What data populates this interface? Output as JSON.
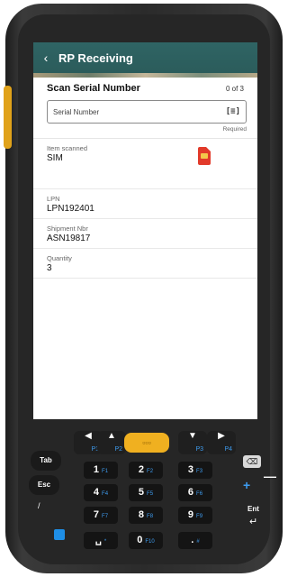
{
  "appbar": {
    "back_icon": "‹",
    "title": "RP Receiving"
  },
  "scan": {
    "title": "Scan Serial Number",
    "counter": "0 of 3",
    "placeholder": "Serial Number",
    "scan_icon_glyph": "[≡]",
    "required_label": "Required"
  },
  "fields": {
    "item": {
      "label": "Item scanned",
      "value": "SIM",
      "icon": "sim-card-icon"
    },
    "lpn": {
      "label": "LPN",
      "value": "LPN192401"
    },
    "shipment": {
      "label": "Shipment Nbr",
      "value": "ASN19817"
    },
    "quantity": {
      "label": "Quantity",
      "value": "3"
    }
  },
  "keypad": {
    "nav": [
      {
        "main": "◀",
        "sub": "P1"
      },
      {
        "main": "▲",
        "sub": "P2"
      },
      {
        "main": "▼",
        "sub": "P3"
      },
      {
        "main": "▶",
        "sub": "P4"
      }
    ],
    "center": "▫▫▫",
    "left_keys": [
      "Tab",
      "Esc"
    ],
    "digits": [
      {
        "main": "1",
        "sub": "F1"
      },
      {
        "main": "2",
        "sub": "F2"
      },
      {
        "main": "3",
        "sub": "F3"
      },
      {
        "main": "4",
        "sub": "F4"
      },
      {
        "main": "5",
        "sub": "F5"
      },
      {
        "main": "6",
        "sub": "F6"
      },
      {
        "main": "7",
        "sub": "F7"
      },
      {
        "main": "8",
        "sub": "F8"
      },
      {
        "main": "9",
        "sub": "F9"
      },
      {
        "main": "␣",
        "sub": "*"
      },
      {
        "main": "0",
        "sub": "F10"
      },
      {
        "main": ".",
        "sub": "#"
      }
    ],
    "backspace": "⌫",
    "plus": "+",
    "minus": "—",
    "enter": "Ent",
    "enter_arrow": "↵",
    "slash": "/"
  },
  "colors": {
    "appbar": "#2f6464",
    "accent": "#f0b020",
    "blue": "#3e9cf0"
  }
}
